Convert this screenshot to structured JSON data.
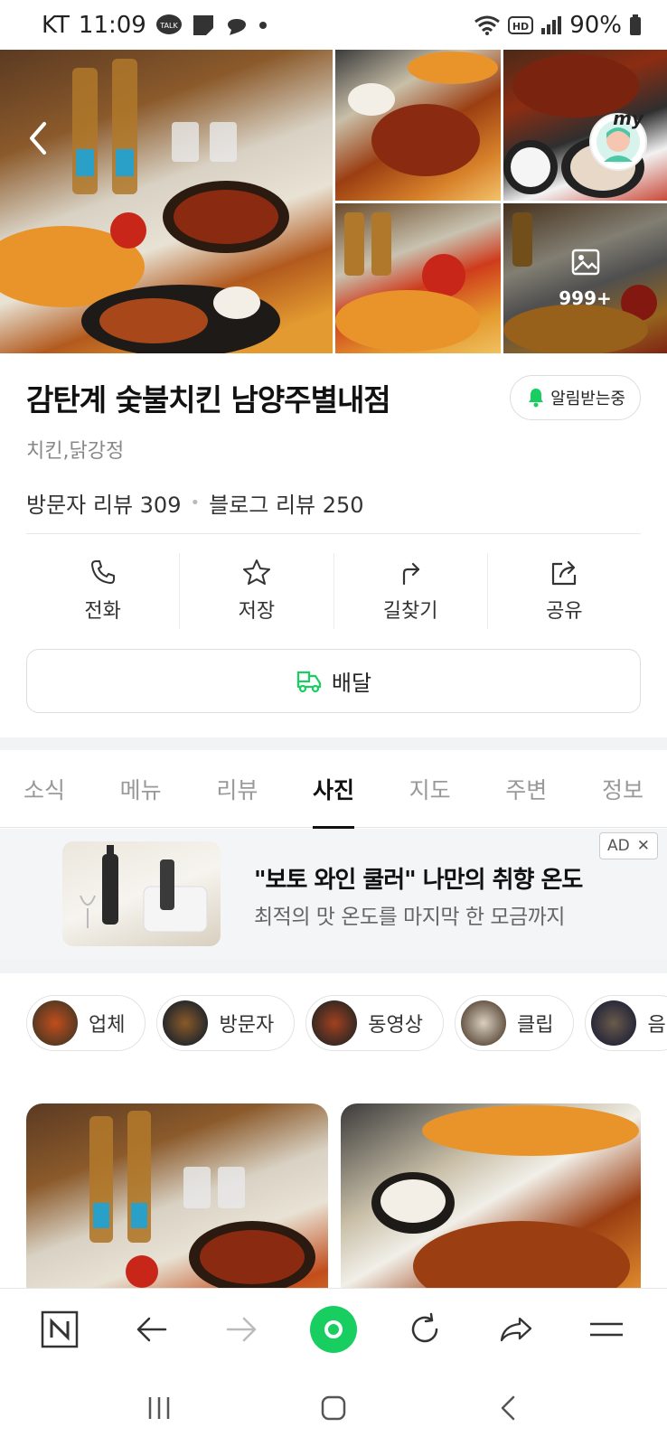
{
  "status_bar": {
    "carrier": "KT",
    "time": "11:09",
    "talk_badge": "TALK",
    "hd_badge": "HD",
    "battery": "90%"
  },
  "gallery_header": {
    "more_count": "999+",
    "my_label": "my"
  },
  "place": {
    "title": "감탄계 숯불치킨 남양주별내점",
    "category": "치킨,닭강정",
    "visitor_reviews": "방문자 리뷰 309",
    "blog_reviews": "블로그 리뷰 250",
    "separator": "•",
    "notify_label": "알림받는중"
  },
  "actions": {
    "call": "전화",
    "save": "저장",
    "directions": "길찾기",
    "share": "공유"
  },
  "delivery": {
    "label": "배달"
  },
  "tabs": [
    {
      "label": "소식"
    },
    {
      "label": "메뉴"
    },
    {
      "label": "리뷰"
    },
    {
      "label": "사진"
    },
    {
      "label": "지도"
    },
    {
      "label": "주변"
    },
    {
      "label": "정보"
    }
  ],
  "active_tab": "사진",
  "ad": {
    "badge": "AD",
    "close": "✕",
    "title": "\"보토 와인 쿨러\" 나만의 취향 온도",
    "subtitle": "최적의 맛 온도를 마지막 한 모금까지"
  },
  "filter_chips": [
    {
      "label": "업체"
    },
    {
      "label": "방문자"
    },
    {
      "label": "동영상"
    },
    {
      "label": "클립"
    },
    {
      "label": "음"
    }
  ],
  "colors": {
    "accent_green": "#19ce60",
    "text_primary": "#111111",
    "text_muted": "#888888"
  }
}
